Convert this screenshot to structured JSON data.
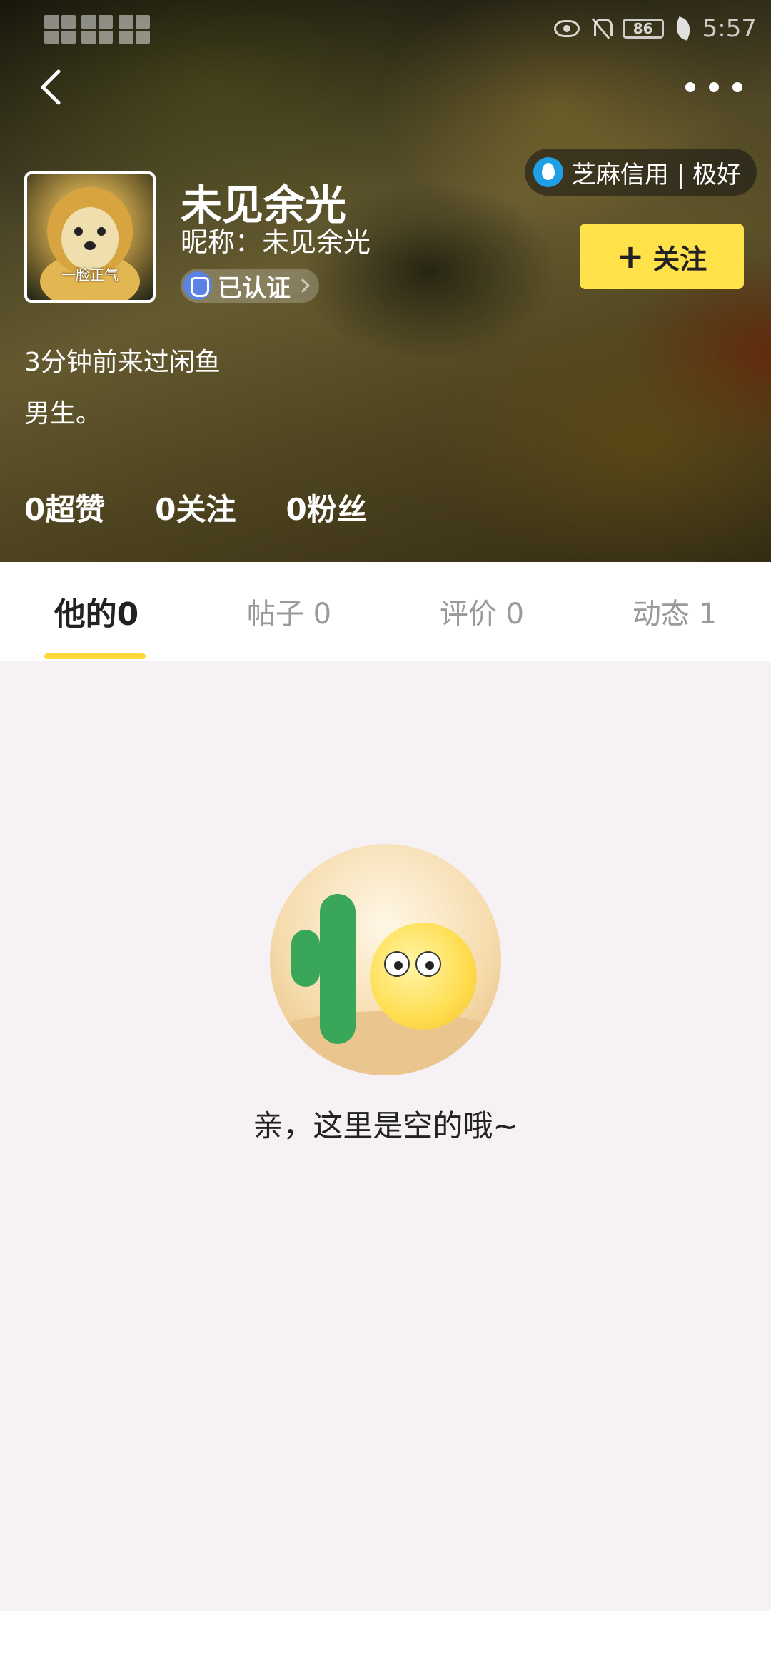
{
  "status_bar": {
    "time": "5:57",
    "battery": "86",
    "icons": [
      "signal-icon",
      "wifi-icon",
      "eye-icon",
      "bell-off-icon",
      "battery-icon",
      "leaf-icon"
    ]
  },
  "nav": {
    "back_icon": "chevron-left-icon",
    "more_icon": "more-horizontal-icon"
  },
  "profile": {
    "avatar_caption": "一脸正气",
    "name": "未见余光",
    "nickname": "昵称：未见余光",
    "verified_label": "已认证",
    "credit": "芝麻信用 | 极好",
    "follow_label": "关注",
    "last_visit": "3分钟前来过闲鱼",
    "bio": "男生。",
    "stats": {
      "likes": "0超赞",
      "following": "0关注",
      "followers": "0粉丝"
    }
  },
  "tabs": [
    {
      "label": "他的0",
      "active": true
    },
    {
      "label": "帖子 0",
      "active": false
    },
    {
      "label": "评价 0",
      "active": false
    },
    {
      "label": "动态 1",
      "active": false
    }
  ],
  "empty_state": {
    "message": "亲，这里是空的哦~",
    "illustration": "fish-cactus-illustration"
  },
  "colors": {
    "accent_yellow": "#ffe14a",
    "tab_indicator": "#ffd73a",
    "background": "#f5f1f5"
  }
}
